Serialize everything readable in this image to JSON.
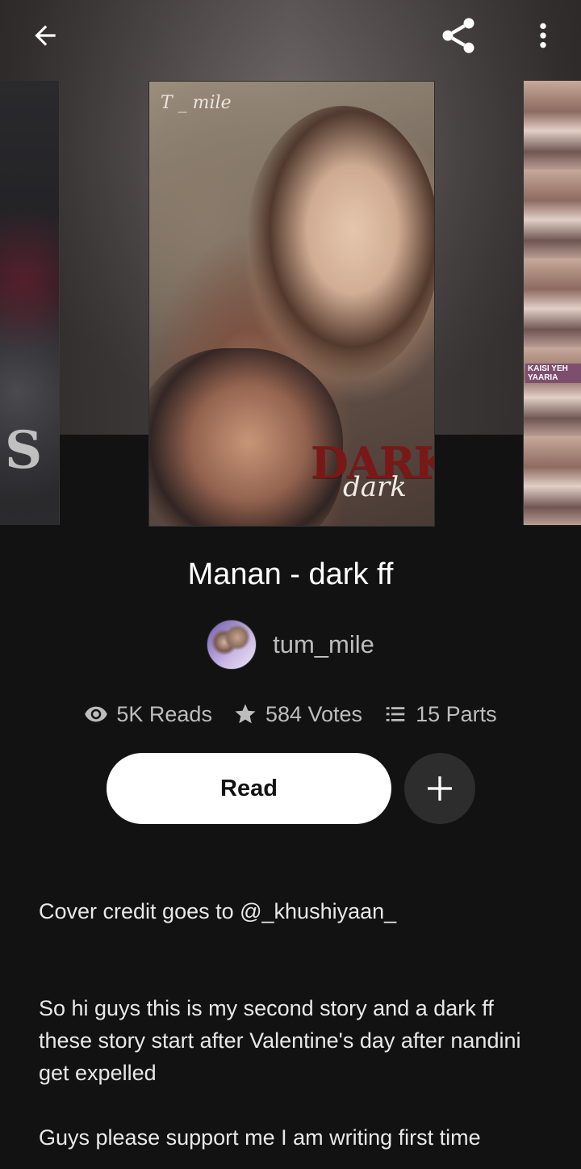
{
  "colors": {
    "background": "#121212",
    "primary_text": "#ffffff",
    "secondary_text": "#bdbdbd",
    "read_button_bg": "#ffffff",
    "add_button_bg": "#2d2d2d"
  },
  "header": {
    "back_icon": "arrow-left-icon",
    "share_icon": "share-icon",
    "more_icon": "more-vertical-icon"
  },
  "covers": {
    "left_deco": "S",
    "main_signature": "T _ mile",
    "main_title": "DARK",
    "main_subtitle": "dark",
    "right_tag": "KAISI YEH YAARIA"
  },
  "story": {
    "title": "Manan - dark ff",
    "author": "tum_mile",
    "stats": {
      "reads": "5K Reads",
      "votes": "584 Votes",
      "parts": "15 Parts"
    },
    "read_label": "Read",
    "add_icon": "plus-icon",
    "description": {
      "p1": "Cover credit goes to @_khushiyaan_",
      "p2": "So hi guys this is my second story and a dark ff these story start after Valentine's day after nandini get expelled",
      "p3": "Guys please support me I am writing first time"
    }
  }
}
